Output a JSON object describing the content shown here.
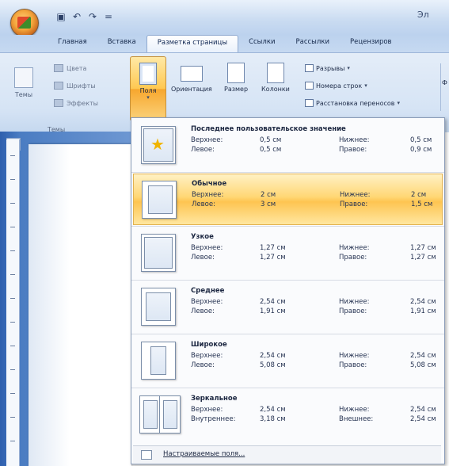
{
  "titlebar": {
    "qat_icons": [
      "save-icon",
      "undo-icon",
      "redo-icon",
      "customize-qat-icon"
    ],
    "qat_glyphs": [
      "▣",
      "↶",
      "↷",
      "="
    ],
    "title_fragment": "Эл"
  },
  "tabs": [
    "Главная",
    "Вставка",
    "Разметка страницы",
    "Ссылки",
    "Рассылки",
    "Рецензиров"
  ],
  "active_tab_index": 2,
  "ribbon": {
    "themes_group": {
      "themes_label": "Темы",
      "colors_label": "Цвета",
      "fonts_label": "Шрифты",
      "effects_label": "Эффекты",
      "group_label": "Темы"
    },
    "page_setup": {
      "fields_label": "Поля",
      "orientation_label": "Ориентация",
      "size_label": "Размер",
      "columns_label": "Колонки",
      "breaks_label": "Разрывы",
      "line_numbers_label": "Номера строк",
      "hyphenation_label": "Расстановка переносов"
    },
    "right_fragment": "Ф"
  },
  "margins_menu": {
    "items": [
      {
        "title": "Последнее пользовательское значение",
        "top_label": "Верхнее:",
        "top": "0,5 см",
        "bottom_label": "Нижнее:",
        "bottom": "0,5 см",
        "left_label": "Левое:",
        "left": "0,5 см",
        "right_label": "Правое:",
        "right": "0,9 см"
      },
      {
        "title": "Обычное",
        "top_label": "Верхнее:",
        "top": "2 см",
        "bottom_label": "Нижнее:",
        "bottom": "2 см",
        "left_label": "Левое:",
        "left": "3 см",
        "right_label": "Правое:",
        "right": "1,5 см"
      },
      {
        "title": "Узкое",
        "top_label": "Верхнее:",
        "top": "1,27 см",
        "bottom_label": "Нижнее:",
        "bottom": "1,27 см",
        "left_label": "Левое:",
        "left": "1,27 см",
        "right_label": "Правое:",
        "right": "1,27 см"
      },
      {
        "title": "Среднее",
        "top_label": "Верхнее:",
        "top": "2,54 см",
        "bottom_label": "Нижнее:",
        "bottom": "2,54 см",
        "left_label": "Левое:",
        "left": "1,91 см",
        "right_label": "Правое:",
        "right": "1,91 см"
      },
      {
        "title": "Широкое",
        "top_label": "Верхнее:",
        "top": "2,54 см",
        "bottom_label": "Нижнее:",
        "bottom": "2,54 см",
        "left_label": "Левое:",
        "left": "5,08 см",
        "right_label": "Правое:",
        "right": "5,08 см"
      },
      {
        "title": "Зеркальное",
        "top_label": "Верхнее:",
        "top": "2,54 см",
        "bottom_label": "Нижнее:",
        "bottom": "2,54 см",
        "left_label": "Внутреннее:",
        "left": "3,18 см",
        "right_label": "Внешнее:",
        "right": "2,54 см"
      }
    ],
    "selected_index": 1,
    "footer_label": "Настраиваемые поля..."
  },
  "colors": {
    "accent": "#ffc851",
    "ribbon_bg": "#d6e4f5",
    "document_bg": "#4a7cc2"
  }
}
